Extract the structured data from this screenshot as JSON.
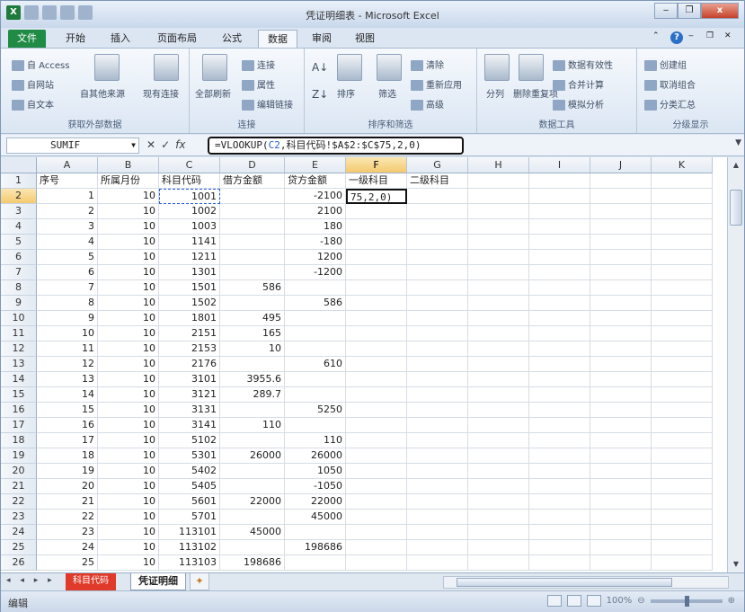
{
  "window": {
    "title": "凭证明细表 - Microsoft Excel",
    "app_icon": "X",
    "controls": [
      "minimize-icon",
      "restore-icon",
      "close-icon"
    ],
    "close_glyph": "x"
  },
  "ribbon_tabs": [
    "文件",
    "开始",
    "插入",
    "页面布局",
    "公式",
    "数据",
    "审阅",
    "视图"
  ],
  "active_tab": "数据",
  "ribbon": {
    "get_external": {
      "label": "获取外部数据",
      "items": [
        "自 Access",
        "自网站",
        "自文本",
        "自其他来源",
        "现有连接"
      ]
    },
    "connections": {
      "label": "连接",
      "items": [
        "全部刷新",
        "连接",
        "属性",
        "编辑链接"
      ]
    },
    "sort_filter": {
      "label": "排序和筛选",
      "items": [
        "排序",
        "筛选",
        "清除",
        "重新应用",
        "高级"
      ]
    },
    "data_tools": {
      "label": "数据工具",
      "items": [
        "分列",
        "删除重复项",
        "数据有效性",
        "合并计算",
        "模拟分析"
      ]
    },
    "outline": {
      "label": "分级显示",
      "items": [
        "创建组",
        "取消组合",
        "分类汇总"
      ]
    }
  },
  "formula_bar": {
    "name_box": "SUMIF",
    "fx_icons": [
      "cancel-icon",
      "enter-icon",
      "fx-icon"
    ],
    "cancel_glyph": "✕",
    "enter_glyph": "✓",
    "fx_glyph": "fx",
    "formula_prefix": "=VLOOKUP(",
    "formula_ref": "C2",
    "formula_rest": ",科目代码!$A$2:$C$75,2,0)"
  },
  "columns": [
    "A",
    "B",
    "C",
    "D",
    "E",
    "F",
    "G",
    "H",
    "I",
    "J",
    "K"
  ],
  "selected_column": "F",
  "selected_row": 2,
  "header_row": [
    "序号",
    "所属月份",
    "科目代码",
    "借方金额",
    "贷方金额",
    "一级科目",
    "二级科目"
  ],
  "rows": [
    {
      "r": "2",
      "a": "1",
      "b": "10",
      "c": "1001",
      "d": "",
      "e": "-2100",
      "f": "75,2,0)"
    },
    {
      "r": "3",
      "a": "2",
      "b": "10",
      "c": "1002",
      "d": "",
      "e": "2100"
    },
    {
      "r": "4",
      "a": "3",
      "b": "10",
      "c": "1003",
      "d": "",
      "e": "180"
    },
    {
      "r": "5",
      "a": "4",
      "b": "10",
      "c": "1141",
      "d": "",
      "e": "-180"
    },
    {
      "r": "6",
      "a": "5",
      "b": "10",
      "c": "1211",
      "d": "",
      "e": "1200"
    },
    {
      "r": "7",
      "a": "6",
      "b": "10",
      "c": "1301",
      "d": "",
      "e": "-1200"
    },
    {
      "r": "8",
      "a": "7",
      "b": "10",
      "c": "1501",
      "d": "586",
      "e": ""
    },
    {
      "r": "9",
      "a": "8",
      "b": "10",
      "c": "1502",
      "d": "",
      "e": "586"
    },
    {
      "r": "10",
      "a": "9",
      "b": "10",
      "c": "1801",
      "d": "495",
      "e": ""
    },
    {
      "r": "11",
      "a": "10",
      "b": "10",
      "c": "2151",
      "d": "165",
      "e": ""
    },
    {
      "r": "12",
      "a": "11",
      "b": "10",
      "c": "2153",
      "d": "10",
      "e": ""
    },
    {
      "r": "13",
      "a": "12",
      "b": "10",
      "c": "2176",
      "d": "",
      "e": "610"
    },
    {
      "r": "14",
      "a": "13",
      "b": "10",
      "c": "3101",
      "d": "3955.6",
      "e": ""
    },
    {
      "r": "15",
      "a": "14",
      "b": "10",
      "c": "3121",
      "d": "289.7",
      "e": ""
    },
    {
      "r": "16",
      "a": "15",
      "b": "10",
      "c": "3131",
      "d": "",
      "e": "5250"
    },
    {
      "r": "17",
      "a": "16",
      "b": "10",
      "c": "3141",
      "d": "110",
      "e": ""
    },
    {
      "r": "18",
      "a": "17",
      "b": "10",
      "c": "5102",
      "d": "",
      "e": "110"
    },
    {
      "r": "19",
      "a": "18",
      "b": "10",
      "c": "5301",
      "d": "26000",
      "e": "26000"
    },
    {
      "r": "20",
      "a": "19",
      "b": "10",
      "c": "5402",
      "d": "",
      "e": "1050"
    },
    {
      "r": "21",
      "a": "20",
      "b": "10",
      "c": "5405",
      "d": "",
      "e": "-1050"
    },
    {
      "r": "22",
      "a": "21",
      "b": "10",
      "c": "5601",
      "d": "22000",
      "e": "22000"
    },
    {
      "r": "23",
      "a": "22",
      "b": "10",
      "c": "5701",
      "d": "",
      "e": "45000"
    },
    {
      "r": "24",
      "a": "23",
      "b": "10",
      "c": "113101",
      "d": "45000",
      "e": ""
    },
    {
      "r": "25",
      "a": "24",
      "b": "10",
      "c": "113102",
      "d": "",
      "e": "198686"
    },
    {
      "r": "26",
      "a": "25",
      "b": "10",
      "c": "113103",
      "d": "198686",
      "e": ""
    }
  ],
  "sheets": {
    "red_tab": "科目代码",
    "current": "凭证明细",
    "nav": "◂ ◂ ▸ ▸"
  },
  "status": {
    "mode": "编辑",
    "zoom": "100%"
  }
}
